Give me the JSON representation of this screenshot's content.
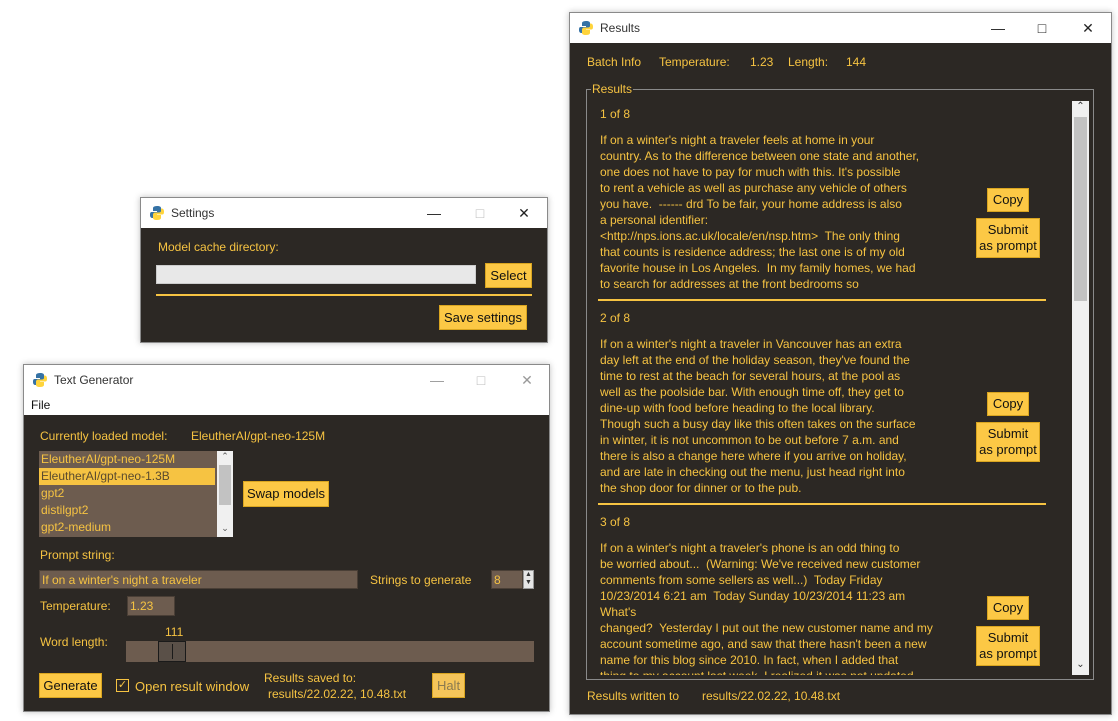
{
  "settings": {
    "title": "Settings",
    "cache_label": "Model cache directory:",
    "cache_value": "",
    "select_label": "Select",
    "save_label": "Save settings"
  },
  "textgen": {
    "title": "Text Generator",
    "menu_file": "File",
    "loaded_label": "Currently loaded model:",
    "loaded_value": "EleutherAI/gpt-neo-125M",
    "models": [
      "EleutherAI/gpt-neo-125M",
      "EleutherAI/gpt-neo-1.3B",
      "gpt2",
      "distilgpt2",
      "gpt2-medium"
    ],
    "selected_model_index": 1,
    "swap_label": "Swap models",
    "prompt_label": "Prompt string:",
    "prompt_value": "If on a winter's night a traveler",
    "strings_label": "Strings to generate",
    "strings_value": "8",
    "temp_label": "Temperature:",
    "temp_value": "1.23",
    "word_label": "Word length:",
    "word_value": "111",
    "word_slider_fraction": 0.085,
    "generate_label": "Generate",
    "open_result_label": "Open result window",
    "open_result_checked": true,
    "results_saved_label": "Results saved to:",
    "results_saved_path": "results/22.02.22, 10.48.txt",
    "halt_label": "Halt"
  },
  "results": {
    "title": "Results",
    "batch_info": "Batch Info",
    "temp_label": "Temperature:",
    "temp_value": "1.23",
    "length_label": "Length:",
    "length_value": "144",
    "frame_label": "Results",
    "copy_label": "Copy",
    "submit_label": "Submit\nas prompt",
    "items": [
      {
        "header": "1 of 8",
        "text": "If on a winter's night a traveler feels at home in your\ncountry. As to the difference between one state and another,\none does not have to pay for much with this. It's possible\nto rent a vehicle as well as purchase any vehicle of others\nyou have.  ------ drd To be fair, your home address is also\na personal identifier:\n<http://nps.ions.ac.uk/locale/en/nsp.htm>  The only thing\nthat counts is residence address; the last one is of my old\nfavorite house in Los Angeles.  In my family homes, we had\nto search for addresses at the front bedrooms so"
      },
      {
        "header": "2 of 8",
        "text": "If on a winter's night a traveler in Vancouver has an extra\nday left at the end of the holiday season, they've found the\ntime to rest at the beach for several hours, at the pool as\nwell as the poolside bar. With enough time off, they get to\ndine-up with food before heading to the local library.\nThough such a busy day like this often takes on the surface\nin winter, it is not uncommon to be out before 7 a.m. and\nthere is also a change here where if you arrive on holiday,\nand are late in checking out the menu, just head right into\nthe shop door for dinner or to the pub."
      },
      {
        "header": "3 of 8",
        "text": "If on a winter's night a traveler's phone is an odd thing to\nbe worried about...  (Warning: We've received new customer\ncomments from some sellers as well...)  Today Friday\n10/23/2014 6:21 am  Today Sunday 10/23/2014 11:23 am\nWhat's\nchanged?  Yesterday I put out the new customer name and my\naccount sometime ago, and saw that there hasn't been a new\nname for this blog since 2010. In fact, when I added that\nthing to my account last week, I realized it was not updated"
      }
    ],
    "written_label": "Results written to",
    "written_path": "results/22.02.22, 10.48.txt"
  },
  "icons": {
    "python": "python-logo-icon",
    "minimize": "minimize-icon",
    "maximize": "maximize-icon",
    "close": "close-icon"
  },
  "colors": {
    "accent": "#f6c342",
    "background": "#2c2824",
    "field": "#6d5c4f",
    "button": "#fcc845"
  }
}
